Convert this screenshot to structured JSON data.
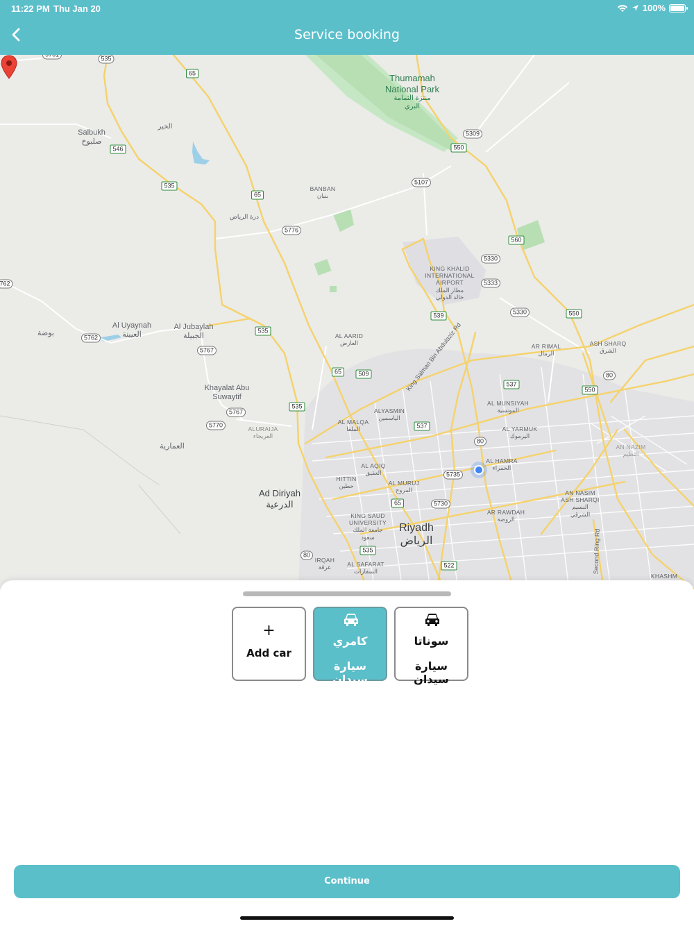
{
  "status_bar": {
    "time": "11:22 PM",
    "date": "Thu Jan 20",
    "battery": "100%",
    "icons": [
      "wifi-icon",
      "location-arrow-icon",
      "battery-icon"
    ]
  },
  "nav": {
    "title": "Service booking",
    "back_icon": "chevron-left-icon"
  },
  "map": {
    "places": {
      "thumamah_en": "Thumamah",
      "thumamah_en2": "National Park",
      "thumamah_ar": "منتزة الثمامة",
      "thumamah_ar2": "البري",
      "salbukh_en": "Salbukh",
      "salbukh_ar": "صلبوخ",
      "alkhair_ar": "الخير",
      "banban_en": "BANBAN",
      "banban_ar": "بنبان",
      "durrat_ar": "درة الرياض",
      "airport_en": "KING KHALID",
      "airport_en2": "INTERNATIONAL",
      "airport_en3": "AIRPORT",
      "airport_ar": "مطار الملك",
      "airport_ar2": "خالد الدولي",
      "uyaynah_en": "Al Uyaynah",
      "uyaynah_ar": "العيينة",
      "jubaylah_en": "Al Jubaylah",
      "jubaylah_ar": "الجبيلة",
      "bawdah_ar": "بوضة",
      "aarid_en": "AL AARID",
      "aarid_ar": "العارض",
      "ar_rimal_en": "AR RIMAL",
      "ar_rimal_ar": "الرمال",
      "ash_sharq_en": "ASH SHARQ",
      "ash_sharq_ar": "الشرق",
      "khayalat_en": "Khayalat Abu",
      "khayalat_en2": "Suwaytif",
      "aluraija_en": "ALURAIJA",
      "aluraija_ar": "العريجاء",
      "ammariyah_ar": "العمارية",
      "alyasmin_en": "ALYASMIN",
      "alyasmin_ar": "الياسمين",
      "malqa_en": "AL MALQA",
      "malqa_ar": "الملقا",
      "munsiyah_en": "AL MUNSIYAH",
      "munsiyah_ar": "المونسية",
      "yarmuk_en": "AL YARMUK",
      "yarmuk_ar": "اليرموك",
      "an_nazim_en": "AN NAZIM",
      "an_nazim_ar": "النظيم",
      "aqiq_en": "AL AQIQ",
      "aqiq_ar": "العقيق",
      "hittin_en": "HITTIN",
      "hittin_ar": "حطين",
      "hamra_en": "AL HAMRA",
      "hamra_ar": "الحمراء",
      "muruj_en": "AL MURUJ",
      "muruj_ar": "المروج",
      "diriyah_en": "Ad Diriyah",
      "diriyah_ar": "الدرعية",
      "ksu_en": "KING SAUD",
      "ksu_en2": "UNIVERSITY",
      "ksu_ar": "جامعة الملك",
      "ksu_ar2": "سعود",
      "riyadh_en": "Riyadh",
      "riyadh_ar": "الرياض",
      "rawdah_en": "AR RAWDAH",
      "rawdah_ar": "الروضة",
      "nasim_en": "AN NASIM",
      "nasim_en2": "ASH SHARQI",
      "nasim_ar": "النسيم",
      "nasim_ar2": "الشرقي",
      "irqah_en": "IRQAH",
      "irqah_ar": "عرقة",
      "safarat_en": "AL SAFARAT",
      "safarat_ar": "السفارات",
      "khashm_en": "KHASHM",
      "kssalman_rd": "King Salman Bin Abdulaziz Rd",
      "second_ring_rd": "Second Ring Rd"
    },
    "shields": [
      "5761",
      "535",
      "65",
      "5309",
      "550",
      "546",
      "535",
      "5107",
      "65",
      "5776",
      "560",
      "5330",
      "5333",
      "762",
      "539",
      "5330",
      "550",
      "5762",
      "5767",
      "535",
      "80",
      "65",
      "509",
      "537",
      "535",
      "5767",
      "5770",
      "550",
      "537",
      "80",
      "5735",
      "65",
      "5730",
      "80",
      "535",
      "522"
    ]
  },
  "cars": {
    "add_label": "Add car",
    "plus": "+",
    "items": [
      {
        "name": "كامري",
        "type": "سيارة سيدان",
        "selected": true,
        "icon": "car-icon"
      },
      {
        "name": "سوناتا",
        "type": "سيارة سيدان",
        "selected": false,
        "icon": "car-icon"
      }
    ]
  },
  "continue_label": "Continue",
  "colors": {
    "accent": "#5bbfca",
    "map_bg": "#ebebe8",
    "road_major": "#f5d26b",
    "park": "#a8d8a8",
    "pin": "#ea4335",
    "location_dot": "#4285f4"
  }
}
